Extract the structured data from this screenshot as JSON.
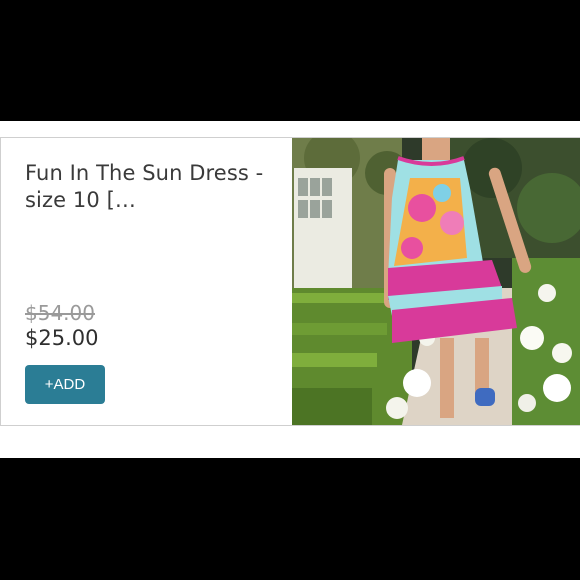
{
  "listing": {
    "title": "Fun In The Sun Dress - size 10 […",
    "original_price": "$54.00",
    "price": "$25.00",
    "add_label": "+ADD"
  },
  "colors": {
    "button": "#2b7d95",
    "dress_pink": "#d83a9a",
    "dress_aqua": "#9fe0e4"
  }
}
